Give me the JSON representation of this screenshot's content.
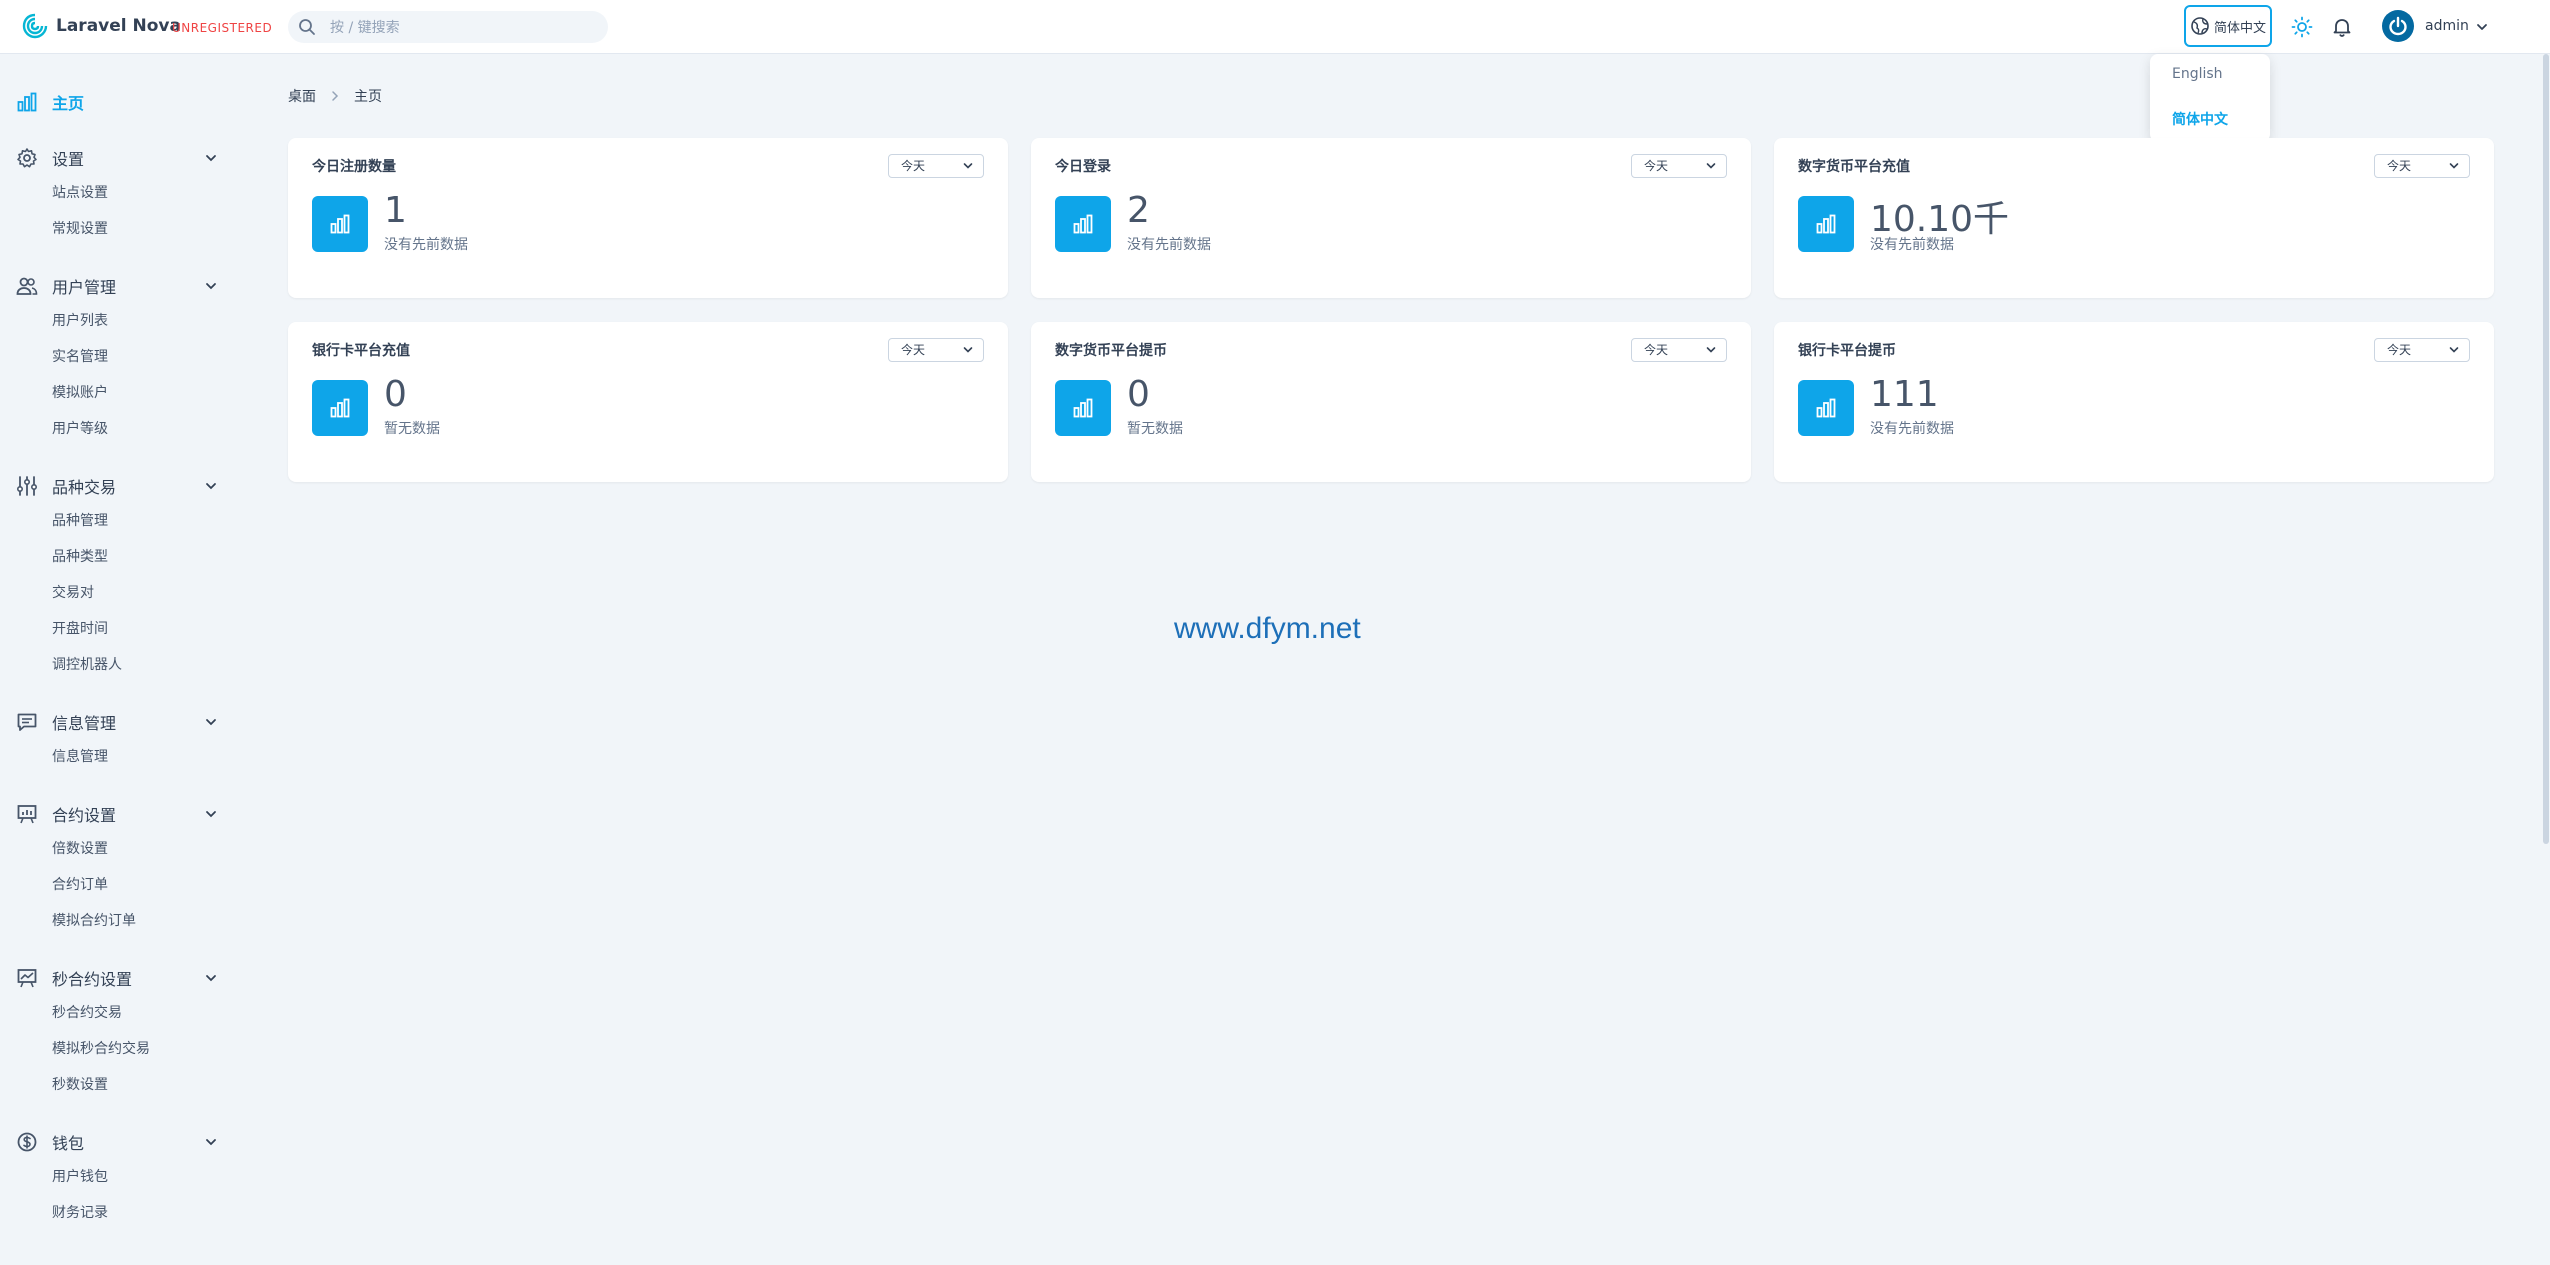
{
  "header": {
    "brand": "Laravel Nova",
    "badge": "UNREGISTERED",
    "search_placeholder": "按 / 键搜索",
    "language_current": "简体中文",
    "user_name": "admin"
  },
  "language_menu": {
    "options": [
      "English",
      "简体中文"
    ],
    "selected": "简体中文"
  },
  "sidebar": {
    "home": "主页",
    "sections": [
      {
        "label": "设置",
        "icon": "gear-icon",
        "items": [
          "站点设置",
          "常规设置"
        ]
      },
      {
        "label": "用户管理",
        "icon": "users-icon",
        "items": [
          "用户列表",
          "实名管理",
          "模拟账户",
          "用户等级"
        ]
      },
      {
        "label": "品种交易",
        "icon": "sliders-icon",
        "items": [
          "品种管理",
          "品种类型",
          "交易对",
          "开盘时间",
          "调控机器人"
        ]
      },
      {
        "label": "信息管理",
        "icon": "chat-icon",
        "items": [
          "信息管理"
        ]
      },
      {
        "label": "合约设置",
        "icon": "presentation-chart-icon",
        "items": [
          "倍数设置",
          "合约订单",
          "模拟合约订单"
        ]
      },
      {
        "label": "秒合约设置",
        "icon": "trend-chart-icon",
        "items": [
          "秒合约交易",
          "模拟秒合约交易",
          "秒数设置"
        ]
      },
      {
        "label": "钱包",
        "icon": "dollar-icon",
        "items": [
          "用户钱包",
          "财务记录"
        ]
      }
    ]
  },
  "breadcrumb": [
    "桌面",
    "主页"
  ],
  "cards": [
    {
      "title": "今日注册数量",
      "range": "今天",
      "value": "1",
      "note": "没有先前数据"
    },
    {
      "title": "今日登录",
      "range": "今天",
      "value": "2",
      "note": "没有先前数据"
    },
    {
      "title": "数字货币平台充值",
      "range": "今天",
      "value": "10.10千",
      "note": "没有先前数据"
    },
    {
      "title": "银行卡平台充值",
      "range": "今天",
      "value": "0",
      "note": "暂无数据"
    },
    {
      "title": "数字货币平台提币",
      "range": "今天",
      "value": "0",
      "note": "暂无数据"
    },
    {
      "title": "银行卡平台提币",
      "range": "今天",
      "value": "111",
      "note": "没有先前数据"
    }
  ],
  "watermark": "www.dfym.net",
  "colors": {
    "accent": "#0ea5e9",
    "danger": "#ef4444",
    "background": "#f1f5f9"
  }
}
